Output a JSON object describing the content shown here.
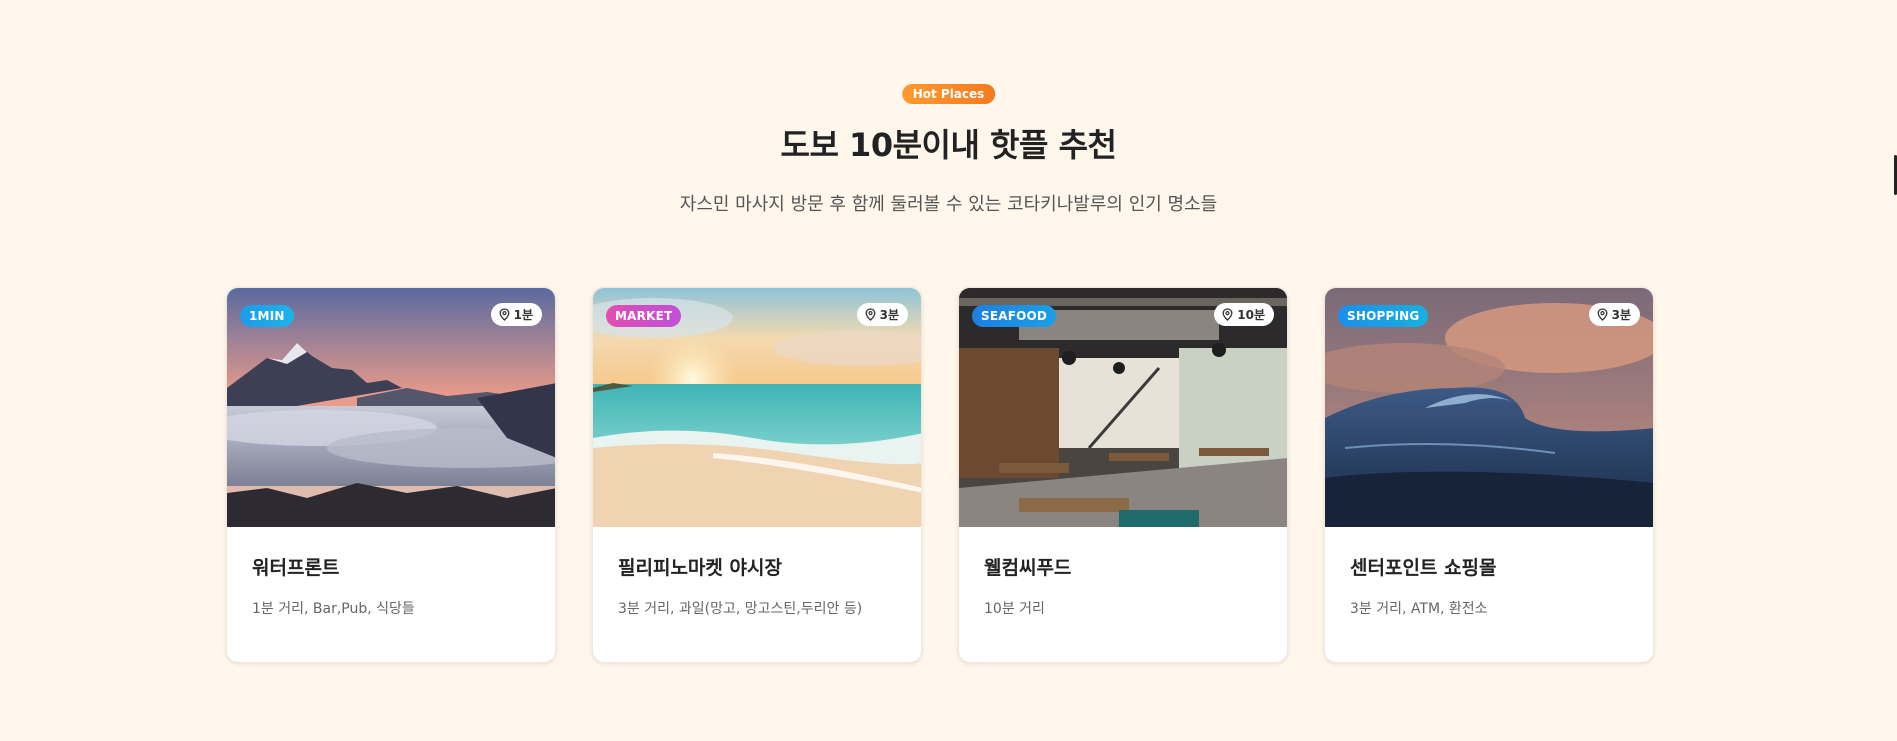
{
  "header": {
    "badge": "Hot Places",
    "title": "도보 10분이내 핫플 추천",
    "subtitle": "자스민 마사지 방문 후 함께 둘러볼 수 있는 코타키나발루의 인기 명소들"
  },
  "cards": [
    {
      "tag": "1MIN",
      "distance": "1분",
      "name": "워터프론트",
      "desc": "1분 거리, Bar,Pub, 식당들",
      "tag_color": "#1e9be8"
    },
    {
      "tag": "MARKET",
      "distance": "3분",
      "name": "필리피노마켓 야시장",
      "desc": "3분 거리, 과일(망고, 망고스틴,두리안 등)",
      "tag_color": "#d94fb5"
    },
    {
      "tag": "SEAFOOD",
      "distance": "10분",
      "name": "웰컴씨푸드",
      "desc": "10분 거리",
      "tag_color": "#1e88e5"
    },
    {
      "tag": "SHOPPING",
      "distance": "3분",
      "name": "센터포인트 쇼핑몰",
      "desc": "3분 거리, ATM, 환전소",
      "tag_color": "#1aa0e8"
    }
  ]
}
